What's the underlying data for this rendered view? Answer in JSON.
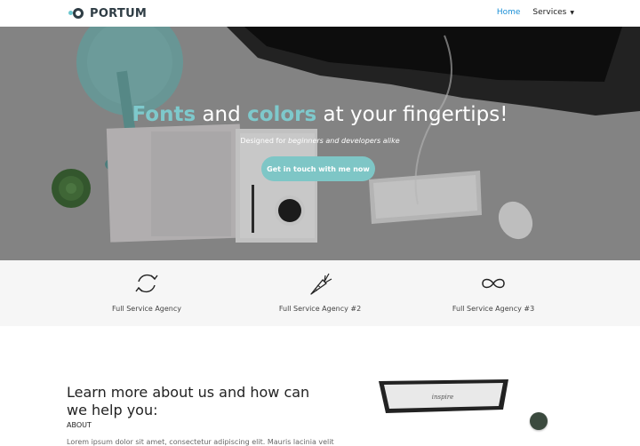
{
  "header": {
    "logo_text": "PORTUM",
    "nav": {
      "home": "Home",
      "services": "Services"
    }
  },
  "hero": {
    "title_word1": "Fonts",
    "title_and": " and ",
    "title_word2": "colors",
    "title_rest": " at your fingertips!",
    "sub_prefix": "Designed for ",
    "sub_emph": "beginners and developers alike",
    "cta_label": "Get in touch with me now"
  },
  "features": [
    {
      "icon": "refresh-icon",
      "label": "Full Service Agency"
    },
    {
      "icon": "carrot-icon",
      "label": "Full Service Agency #2"
    },
    {
      "icon": "infinity-icon",
      "label": "Full Service Agency #3"
    }
  ],
  "about": {
    "title": "Learn more about us and how can we help you:",
    "subtitle": "ABOUT",
    "body": "Lorem ipsum dolor sit amet, consectetur adipiscing elit. Mauris lacinia velit"
  },
  "colors": {
    "accent": "#7ec9cc",
    "nav_active": "#1a8fd6",
    "logo_dark": "#2f3d45"
  }
}
